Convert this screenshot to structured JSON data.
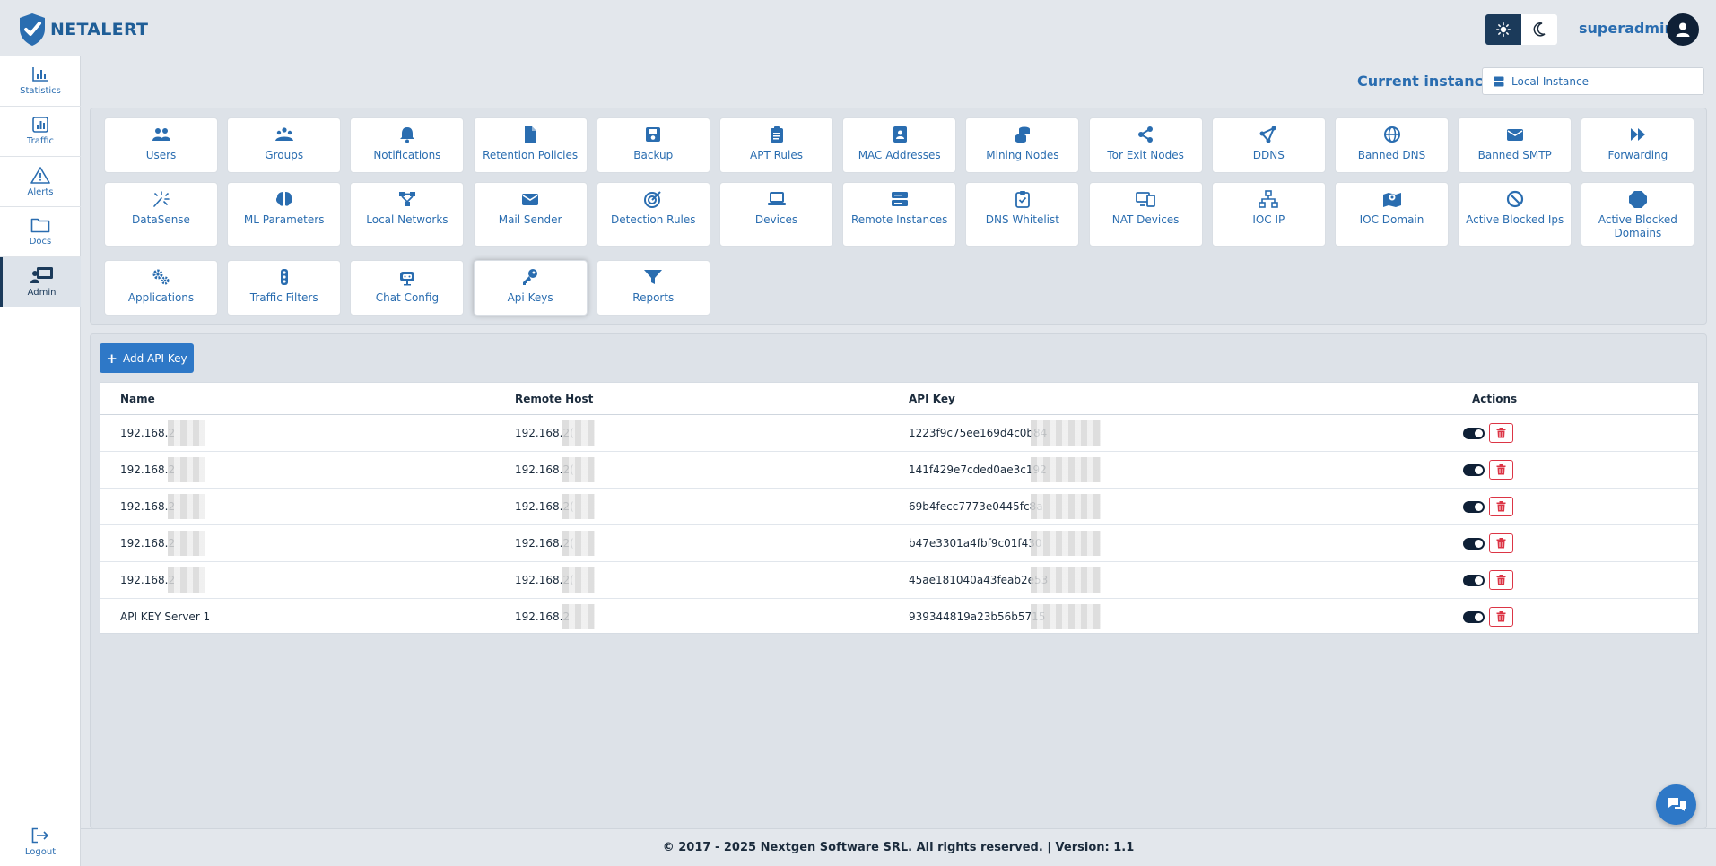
{
  "app": {
    "name": "NETALERT"
  },
  "header": {
    "username": "superadmin"
  },
  "sidebar": {
    "items": [
      {
        "label": "Statistics"
      },
      {
        "label": "Traffic"
      },
      {
        "label": "Alerts"
      },
      {
        "label": "Docs"
      },
      {
        "label": "Admin"
      }
    ],
    "logout": "Logout",
    "active": "Admin"
  },
  "instance": {
    "label": "Current instance:",
    "value": "Local Instance"
  },
  "tiles": [
    {
      "label": "Users",
      "icon": "users-icon"
    },
    {
      "label": "Groups",
      "icon": "groups-icon"
    },
    {
      "label": "Notifications",
      "icon": "bell-icon"
    },
    {
      "label": "Retention Policies",
      "icon": "file-icon"
    },
    {
      "label": "Backup",
      "icon": "save-icon"
    },
    {
      "label": "APT Rules",
      "icon": "clipboard-icon"
    },
    {
      "label": "MAC Addresses",
      "icon": "address-book-icon"
    },
    {
      "label": "Mining Nodes",
      "icon": "coins-icon"
    },
    {
      "label": "Tor Exit Nodes",
      "icon": "share-icon"
    },
    {
      "label": "DDNS",
      "icon": "nodes-icon"
    },
    {
      "label": "Banned DNS",
      "icon": "globe-icon"
    },
    {
      "label": "Banned SMTP",
      "icon": "envelope-icon"
    },
    {
      "label": "Forwarding",
      "icon": "forward-icon"
    },
    {
      "label": "DataSense",
      "icon": "sparkle-icon"
    },
    {
      "label": "ML Parameters",
      "icon": "brain-icon"
    },
    {
      "label": "Local Networks",
      "icon": "network-icon"
    },
    {
      "label": "Mail Sender",
      "icon": "envelope-icon"
    },
    {
      "label": "Detection Rules",
      "icon": "target-icon"
    },
    {
      "label": "Devices",
      "icon": "laptop-icon"
    },
    {
      "label": "Remote Instances",
      "icon": "server-icon"
    },
    {
      "label": "DNS Whitelist",
      "icon": "clipboard-check-icon"
    },
    {
      "label": "NAT Devices",
      "icon": "devices-icon"
    },
    {
      "label": "IOC IP",
      "icon": "sitemap-icon"
    },
    {
      "label": "IOC Domain",
      "icon": "map-pin-icon"
    },
    {
      "label": "Active Blocked Ips",
      "icon": "ban-icon"
    },
    {
      "label": "Active Blocked Domains",
      "icon": "stop-icon"
    },
    {
      "label": "Applications",
      "icon": "gears-icon"
    },
    {
      "label": "Traffic Filters",
      "icon": "traffic-light-icon"
    },
    {
      "label": "Chat Config",
      "icon": "robot-icon"
    },
    {
      "label": "Api Keys",
      "icon": "key-icon"
    },
    {
      "label": "Reports",
      "icon": "filter-icon"
    }
  ],
  "active_tile": "Api Keys",
  "api": {
    "add_label": "Add API Key",
    "columns": [
      "Name",
      "Remote Host",
      "API Key",
      "Actions"
    ],
    "rows": [
      {
        "name": "192.168.2",
        "host": "192.168.2(",
        "key": "1223f9c75ee169d4c0b84",
        "enabled": true
      },
      {
        "name": "192.168.2",
        "host": "192.168.2(",
        "key": "141f429e7cded0ae3c192",
        "enabled": true
      },
      {
        "name": "192.168.2",
        "host": "192.168.2(",
        "key": "69b4fecc7773e0445fc8a",
        "enabled": true
      },
      {
        "name": "192.168.2",
        "host": "192.168.2(",
        "key": "b47e3301a4fbf9c01f430",
        "enabled": true
      },
      {
        "name": "192.168.2",
        "host": "192.168.2(",
        "key": "45ae181040a43feab2e53",
        "enabled": true
      },
      {
        "name": "API KEY Server 1",
        "host": "192.168.2",
        "key": "939344819a23b56b5715",
        "enabled": true
      }
    ]
  },
  "footer": {
    "text": "© 2017 - 2025 Nextgen Software SRL. All rights reserved. | Version: 1.1"
  },
  "colors": {
    "accent": "#2a6db0",
    "primary_button": "#2e78c7",
    "dark": "#0f2036",
    "danger": "#dc3545"
  }
}
